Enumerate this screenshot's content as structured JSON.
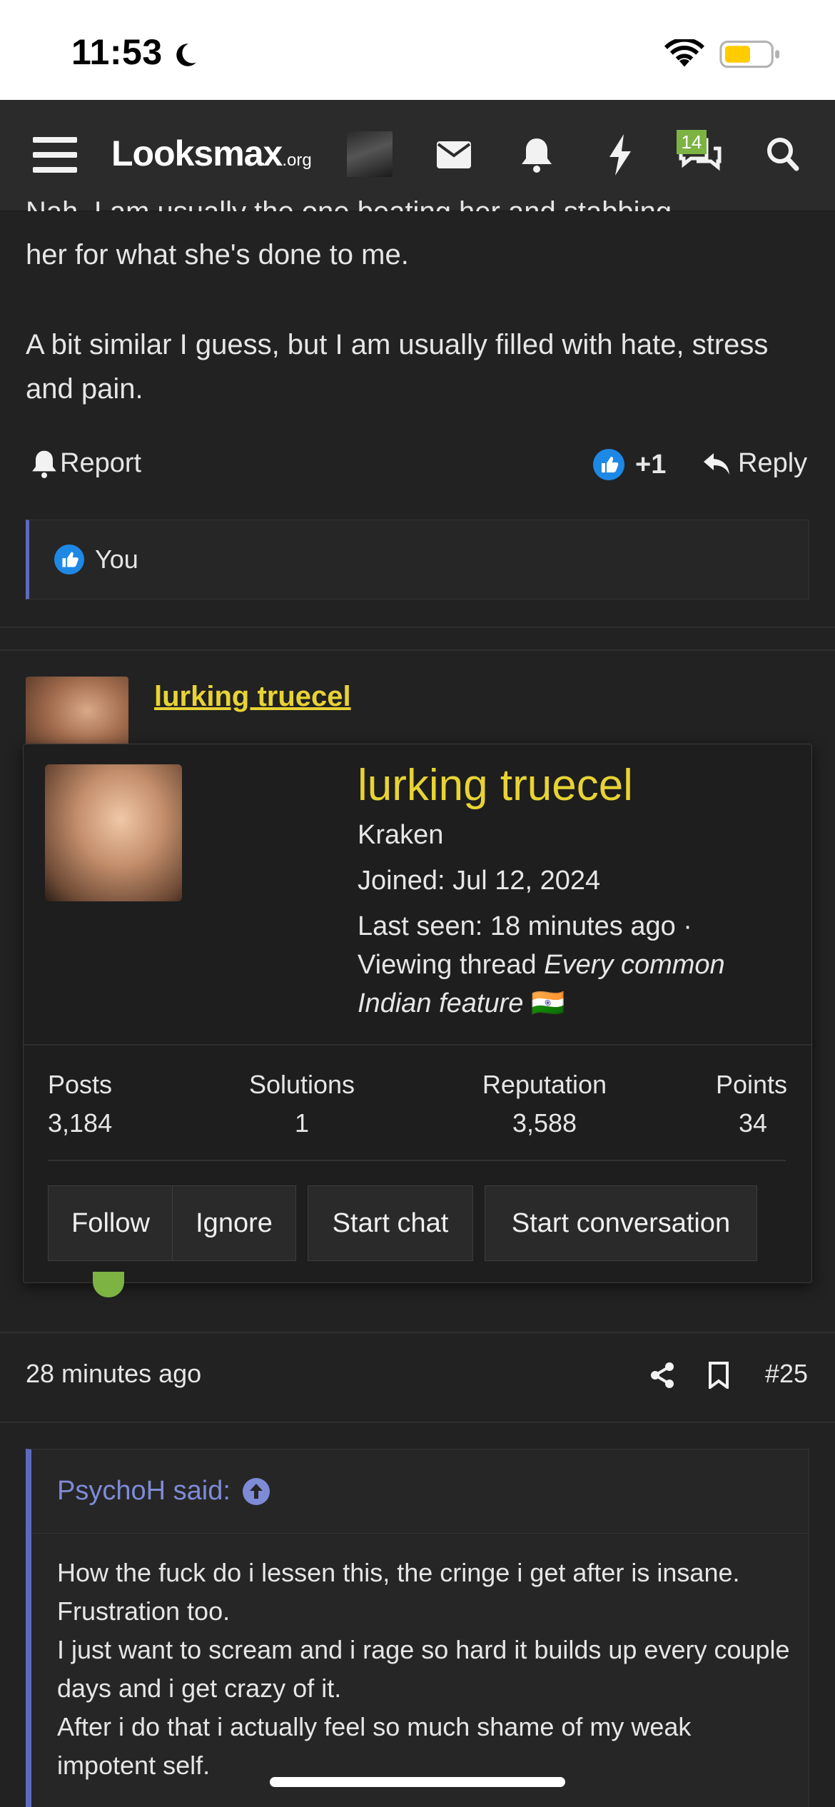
{
  "status_bar": {
    "time": "11:53"
  },
  "header": {
    "logo_main": "Looksmax",
    "logo_tld": ".org",
    "conversation_badge": "14"
  },
  "post1": {
    "text_partial": "Nah, I am usually the one beating her and stabbing",
    "text_line2": "her for what she's done to me.",
    "text_para2": "A bit similar I guess, but I am usually filled with hate, stress and pain.",
    "report_label": "Report",
    "like_count": "+1",
    "reply_label": "Reply",
    "reactions_text": "You"
  },
  "post2": {
    "username": "lurking truecel"
  },
  "member_tooltip": {
    "name": "lurking truecel",
    "title": "Kraken",
    "joined": "Joined: Jul 12, 2024",
    "last_seen": "Last seen: 18 minutes ago ·",
    "viewing_prefix": "Viewing thread ",
    "viewing_thread": "Every common Indian feature",
    "flag": "🇮🇳",
    "stats": [
      {
        "label": "Posts",
        "value": "3,184"
      },
      {
        "label": "Solutions",
        "value": "1"
      },
      {
        "label": "Reputation",
        "value": "3,588"
      },
      {
        "label": "Points",
        "value": "34"
      }
    ],
    "buttons": {
      "follow": "Follow",
      "ignore": "Ignore",
      "start_chat": "Start chat",
      "start_conversation": "Start conversation"
    }
  },
  "post3": {
    "time": "28 minutes ago",
    "number": "#25",
    "quote_author": "PsychoH said:",
    "quote_lines": [
      "How the fuck do i lessen this, the cringe i get after is insane. Frustration too.",
      "I just want to scream and i rage so hard it builds up every couple days and i get crazy of it.",
      "After i do that i actually feel so much shame of my weak impotent self."
    ]
  },
  "colors": {
    "accent_yellow": "#e8d334",
    "quote_accent": "#5c6bc0",
    "badge_green": "#7cb342",
    "like_blue": "#1e88e5"
  }
}
